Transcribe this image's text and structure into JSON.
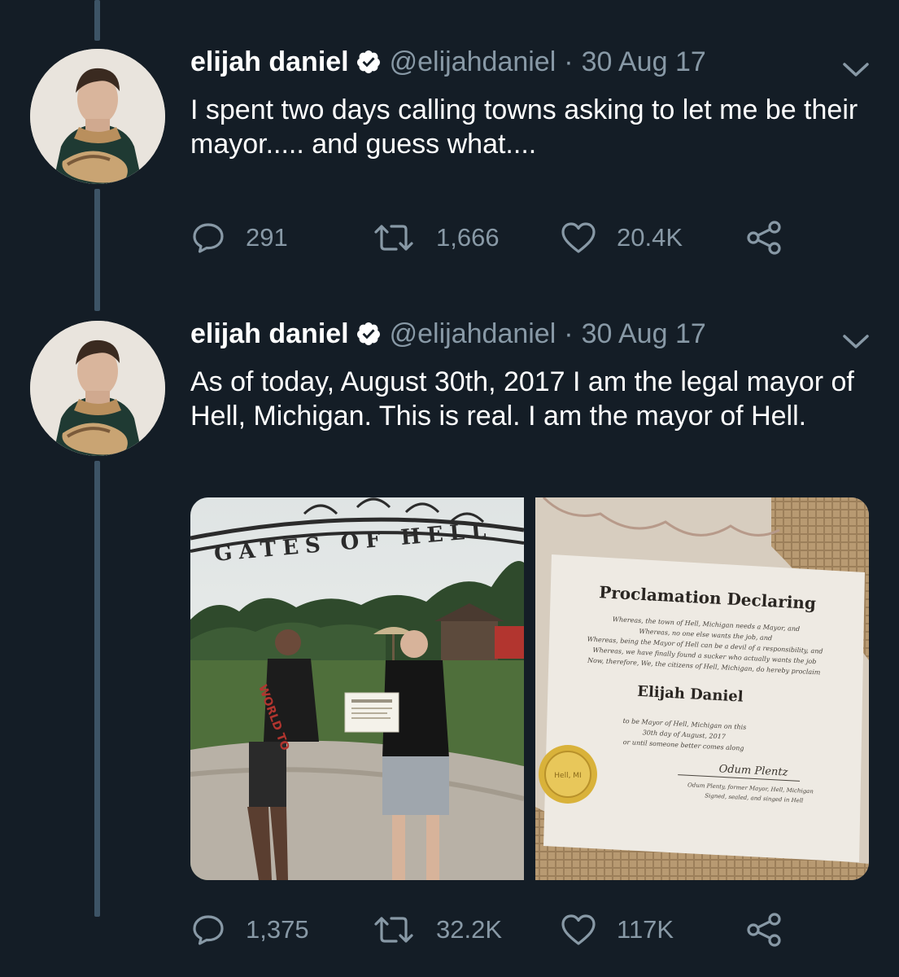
{
  "thread": {
    "tweets": [
      {
        "author_name": "elijah daniel",
        "handle": "@elijahdaniel",
        "separator": "·",
        "date": "30 Aug 17",
        "text": "I spent two days calling towns asking to let me be their mayor..... and guess what....",
        "replies": "291",
        "retweets": "1,666",
        "likes": "20.4K"
      },
      {
        "author_name": "elijah daniel",
        "handle": "@elijahdaniel",
        "separator": "·",
        "date": "30 Aug 17",
        "text": "As of today, August 30th, 2017 I am the legal mayor of Hell, Michigan. This is real. I am the mayor of Hell.",
        "replies": "1,375",
        "retweets": "32.2K",
        "likes": "117K"
      }
    ]
  },
  "media": {
    "photo1": {
      "gate_text": "GATES OF HELL",
      "shirt_text": "WORLD TO"
    },
    "photo2": {
      "title": "Proclamation Declaring",
      "lines": [
        "Whereas, the town of Hell, Michigan needs a Mayor, and",
        "Whereas, no one else wants the job, and",
        "Whereas, being the Mayor of Hell can be a devil of a responsibility, and",
        "Whereas, we have finally found a sucker who actually wants the job",
        "Now, therefore, We, the citizens of Hell, Michigan, do hereby proclaim"
      ],
      "honoree": "Elijah Daniel",
      "closing": [
        "to be Mayor of Hell, Michigan on this",
        "30th day of August, 2017",
        "or until someone better comes along"
      ],
      "signature": "Odum Plentz",
      "signer_lines": [
        "Odum Plenty, former Mayor, Hell, Michigan",
        "Signed, sealed, and singed in Hell"
      ],
      "seal_text": "Hell, MI"
    }
  },
  "icons": {
    "reply": "reply-icon",
    "retweet": "retweet-icon",
    "like": "heart-icon",
    "share": "share-icon",
    "verified": "verified-badge-icon",
    "menu": "chevron-down-icon"
  },
  "colors": {
    "background": "#141d26",
    "secondary_text": "#8899a6",
    "thread_line": "#3d5466",
    "verified_badge": "#ffffff"
  }
}
